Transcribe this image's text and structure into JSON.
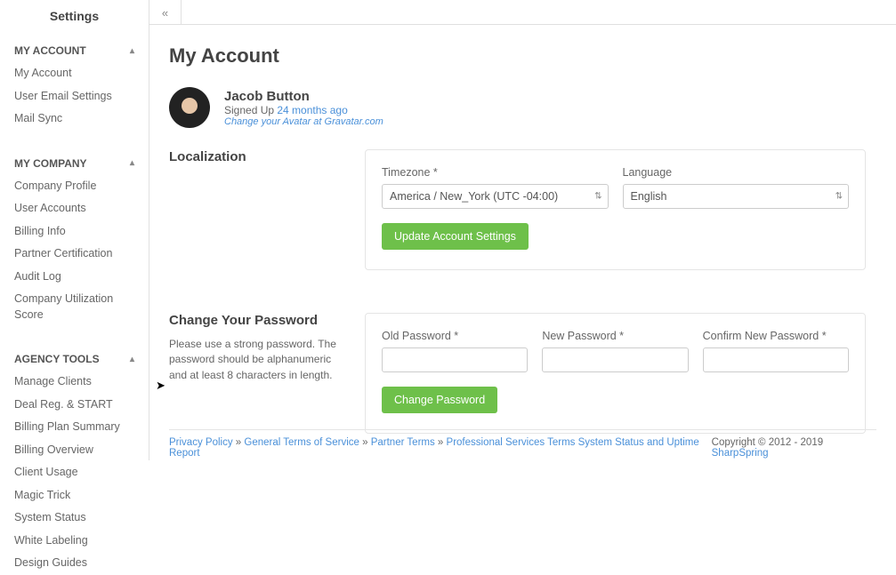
{
  "sidebar": {
    "title": "Settings",
    "sections": [
      {
        "label": "MY ACCOUNT",
        "items": [
          "My Account",
          "User Email Settings",
          "Mail Sync"
        ]
      },
      {
        "label": "MY COMPANY",
        "items": [
          "Company Profile",
          "User Accounts",
          "Billing Info",
          "Partner Certification",
          "Audit Log",
          "Company Utilization Score"
        ]
      },
      {
        "label": "AGENCY TOOLS",
        "items": [
          "Manage Clients",
          "Deal Reg. & START",
          "Billing Plan Summary",
          "Billing Overview",
          "Client Usage",
          "Magic Trick",
          "System Status",
          "White Labeling",
          "Design Guides"
        ]
      }
    ]
  },
  "page": {
    "title": "My Account"
  },
  "profile": {
    "name": "Jacob Button",
    "signed_up_prefix": "Signed Up ",
    "signed_up_link": "24 months ago",
    "gravatar": "Change your Avatar at Gravatar.com"
  },
  "localization": {
    "title": "Localization",
    "timezone_label": "Timezone *",
    "timezone_value": "America / New_York (UTC -04:00)",
    "language_label": "Language",
    "language_value": "English",
    "update_btn": "Update Account Settings"
  },
  "password": {
    "title": "Change Your Password",
    "help": "Please use a strong password. The password should be alphanumeric and at least 8 characters in length.",
    "old_label": "Old Password *",
    "new_label": "New Password *",
    "confirm_label": "Confirm New Password *",
    "change_btn": "Change Password"
  },
  "footer": {
    "privacy": "Privacy Policy",
    "sep": " » ",
    "general": "General Terms of Service",
    "partner": "Partner Terms",
    "pro": "Professional Services Terms",
    "status": "System Status and Uptime Report",
    "copyright_prefix": "Copyright © 2012 - 2019 ",
    "brand": "SharpSpring"
  }
}
